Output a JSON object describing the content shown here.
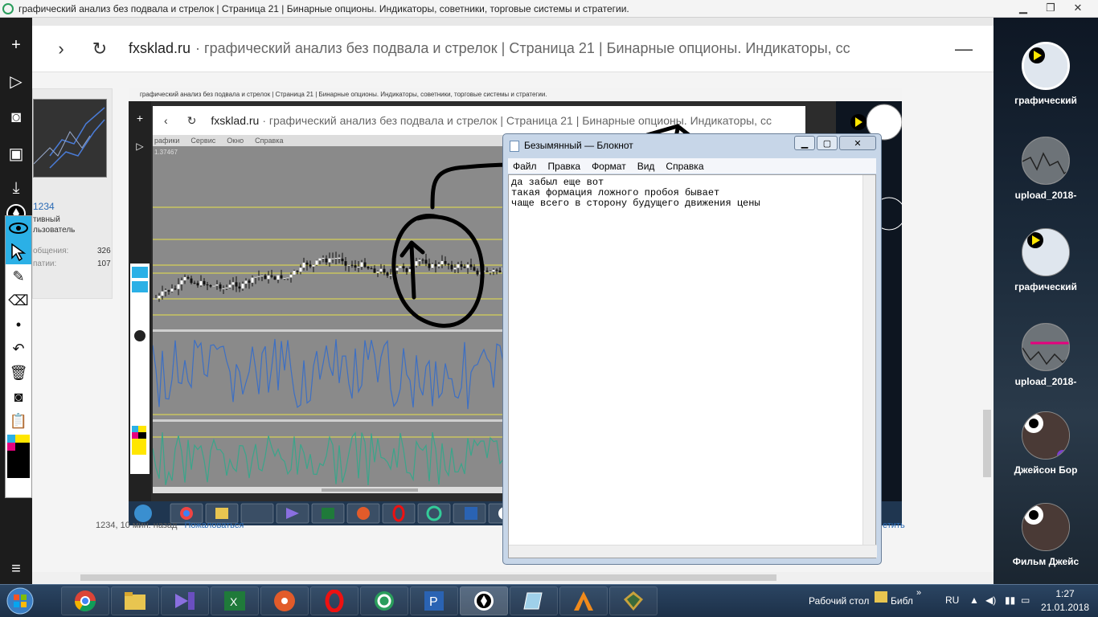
{
  "window": {
    "title": "графический анализ без подвала и стрелок | Страница 21 | Бинарные опционы. Индикаторы, советники, торговые системы и стратегии."
  },
  "browser": {
    "domain": "fxsklad.ru",
    "page_title": "· графический анализ без подвала и стрелок | Страница 21 | Бинарные опционы. Индикаторы, сс"
  },
  "user_card": {
    "name": "1234",
    "status_line1": "тивный",
    "status_line2": "льзователь",
    "stats": [
      {
        "label": "общения:",
        "value": "326"
      },
      {
        "label": "патии:",
        "value": "107"
      }
    ]
  },
  "nested_screenshot": {
    "title": "графический анализ без подвала и стрелок | Страница 21 | Бинарные опционы. Индикаторы, советники, торговые системы и стратегии.",
    "domain": "fxsklad.ru",
    "page_title": "· графический анализ без подвала и стрелок | Страница 21 | Бинарные опционы. Индикаторы, сс",
    "menu": [
      "рафики",
      "Сервис",
      "Окно",
      "Справка"
    ],
    "price": "1.37467"
  },
  "notepad": {
    "title": "Безымянный — Блокнот",
    "menu": [
      "Файл",
      "Правка",
      "Формат",
      "Вид",
      "Справка"
    ],
    "text": "да забыл еще вот\nтакая формация ложного пробоя бывает\nчаще всего в сторону будущего движения цены"
  },
  "footer": {
    "meta": "1234, 10 мин. назад",
    "report": "Пожаловаться",
    "right_link": "етить"
  },
  "right_panel": {
    "items": [
      "графический",
      "upload_2018-",
      "графический",
      "upload_2018-",
      "Джейсон Бор",
      "Фильм Джейс"
    ]
  },
  "taskbar": {
    "desktop_label": "Рабочий стол",
    "folder_label": "Библ",
    "lang": "RU",
    "time": "1:27",
    "date": "21.01.2018"
  },
  "colors": {
    "chart_bg": "#8a8a8a",
    "level_line": "#e8e24a",
    "oscillator_blue": "#3c6fc4",
    "oscillator_teal": "#3aa58a",
    "accent_blue": "#2bb0e6"
  }
}
